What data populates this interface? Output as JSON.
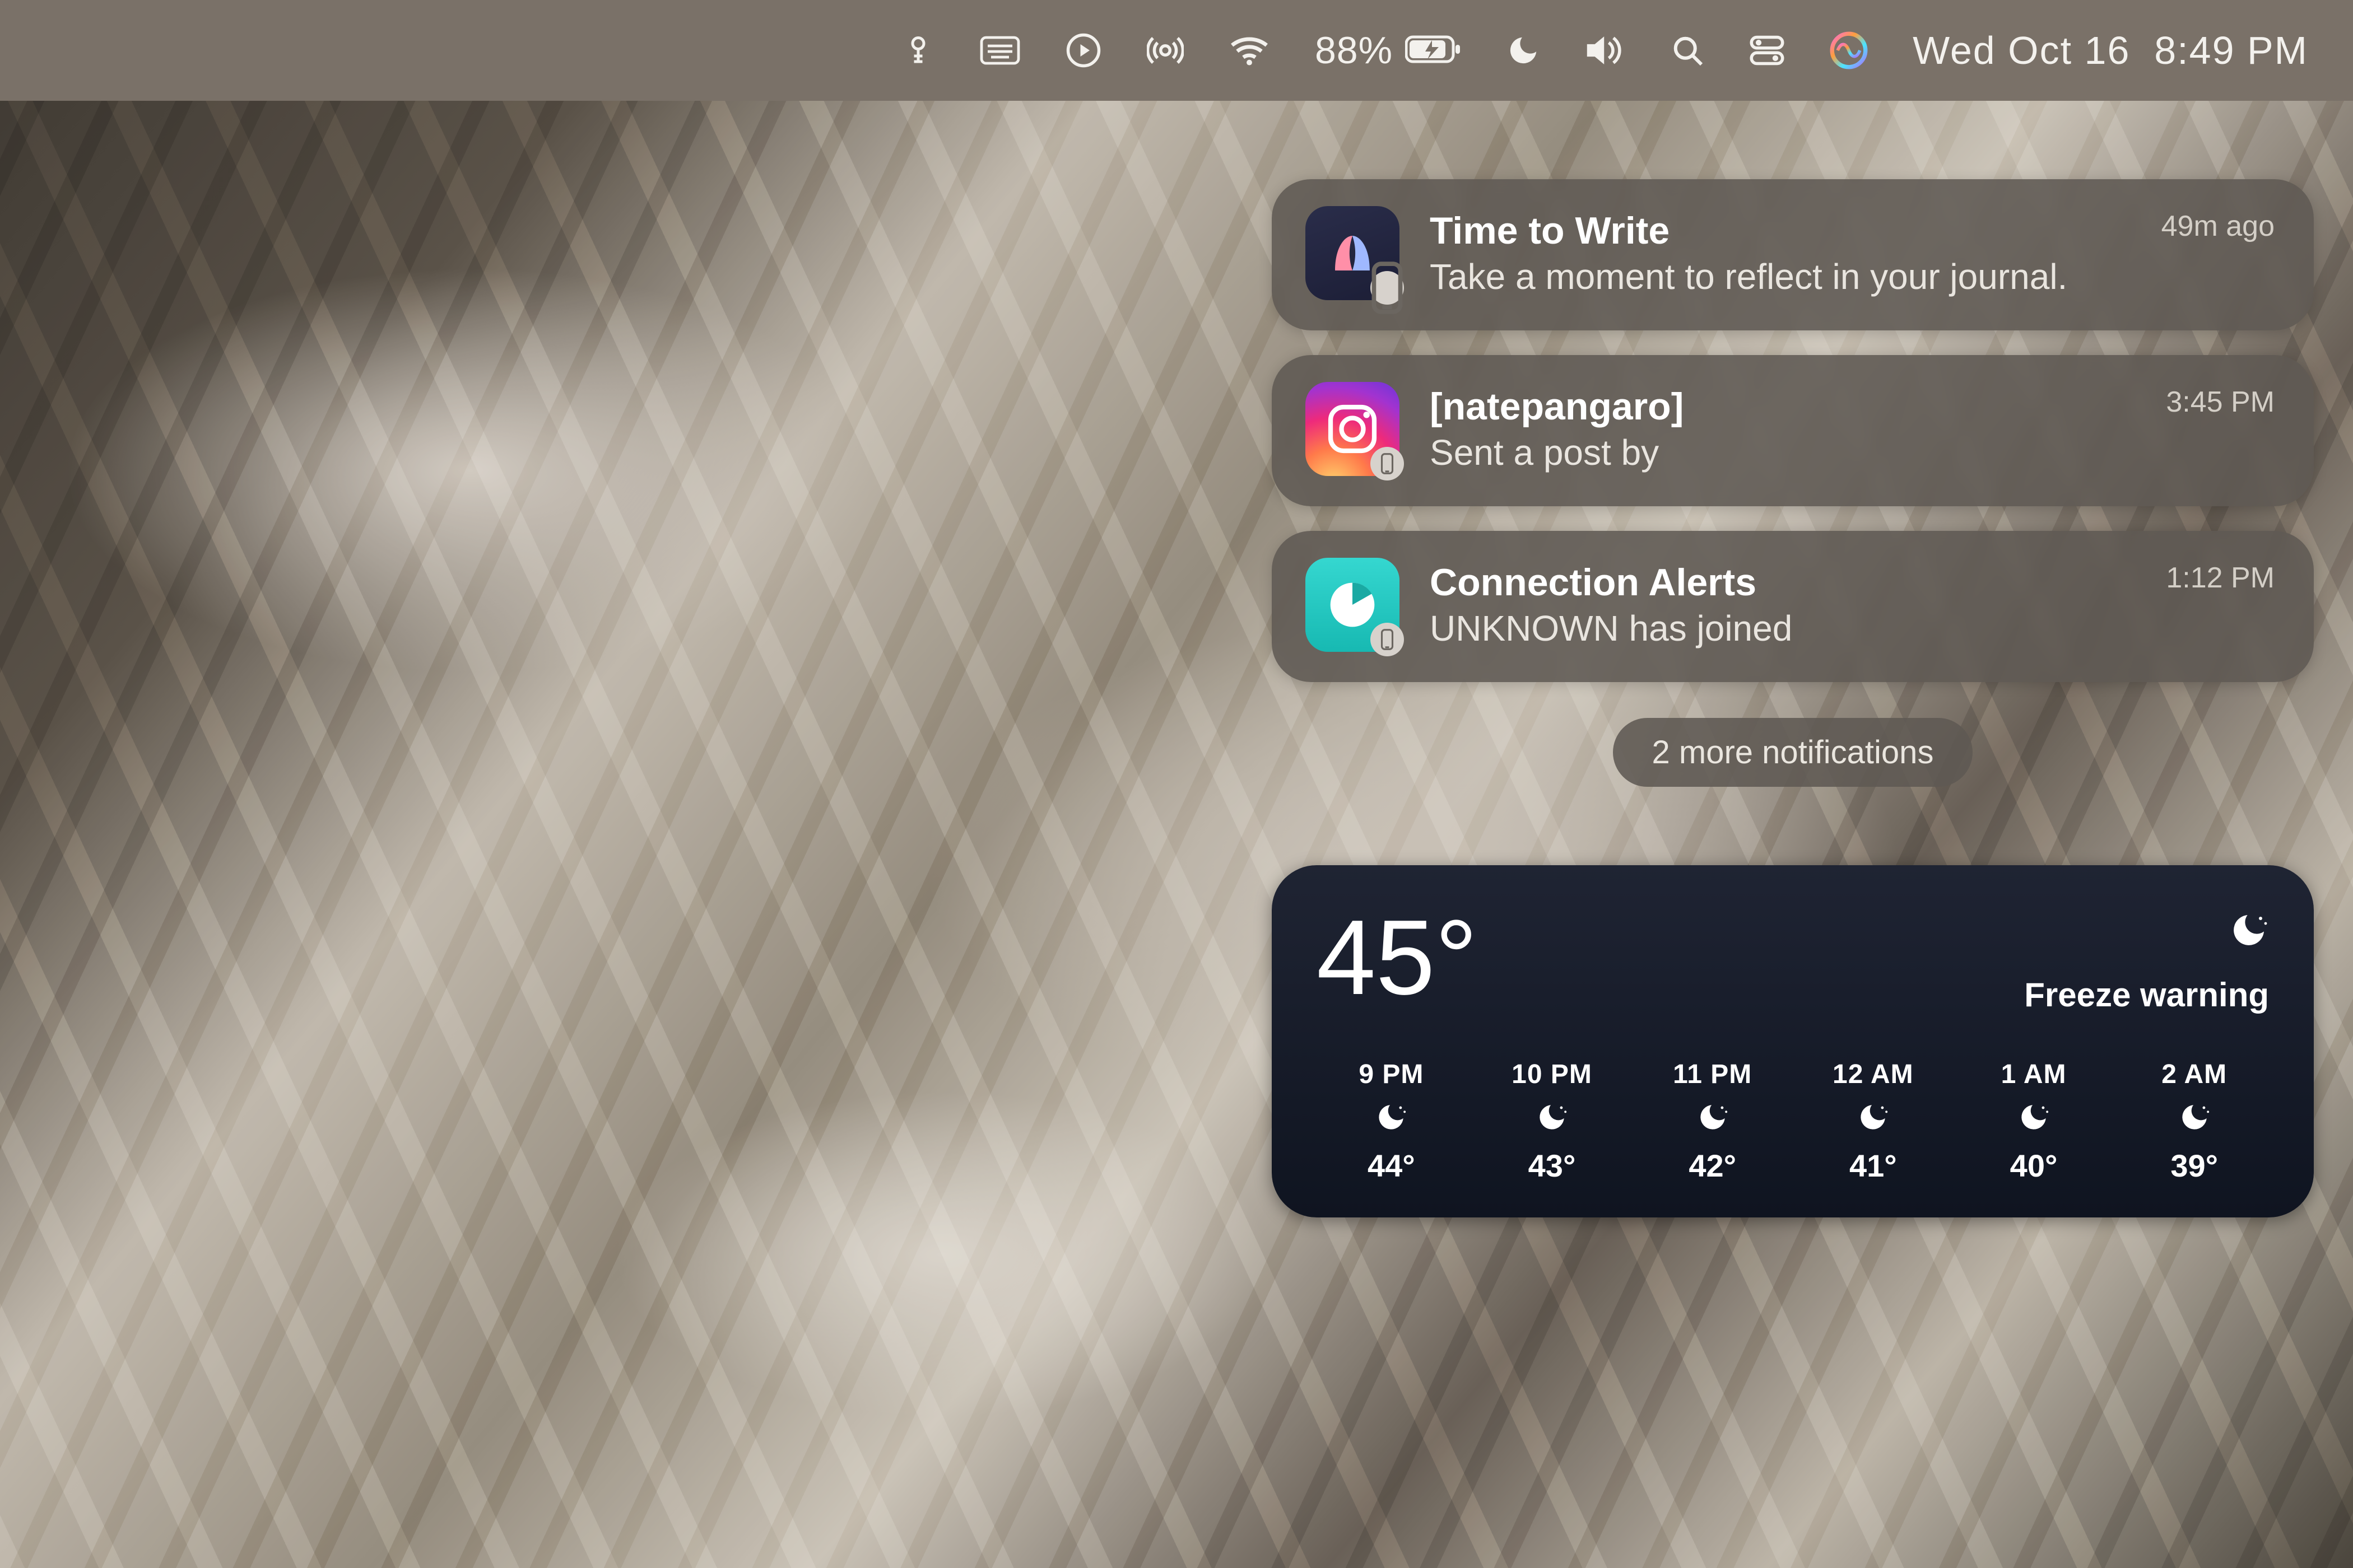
{
  "menubar": {
    "battery_percent": "88%",
    "date": "Wed Oct 16",
    "time": "8:49 PM"
  },
  "notifications": [
    {
      "app_icon": "journal",
      "title": "Time to Write",
      "subtitle": "Take a moment to reflect in your journal.",
      "timestamp": "49m ago"
    },
    {
      "app_icon": "instagram",
      "title": "[natepangaro]",
      "subtitle": "Sent a post by",
      "timestamp": "3:45 PM"
    },
    {
      "app_icon": "connection-alerts",
      "title": "Connection Alerts",
      "subtitle": "UNKNOWN has joined",
      "timestamp": "1:12 PM"
    }
  ],
  "more_notifications_label": "2 more notifications",
  "weather": {
    "current_temp": "45°",
    "alert": "Freeze warning",
    "condition_icon": "night-clear",
    "hourly": [
      {
        "label": "9 PM",
        "icon": "night-clear",
        "temp": "44°"
      },
      {
        "label": "10 PM",
        "icon": "night-clear",
        "temp": "43°"
      },
      {
        "label": "11 PM",
        "icon": "night-clear",
        "temp": "42°"
      },
      {
        "label": "12 AM",
        "icon": "night-clear",
        "temp": "41°"
      },
      {
        "label": "1 AM",
        "icon": "night-clear",
        "temp": "40°"
      },
      {
        "label": "2 AM",
        "icon": "night-clear",
        "temp": "39°"
      }
    ]
  }
}
